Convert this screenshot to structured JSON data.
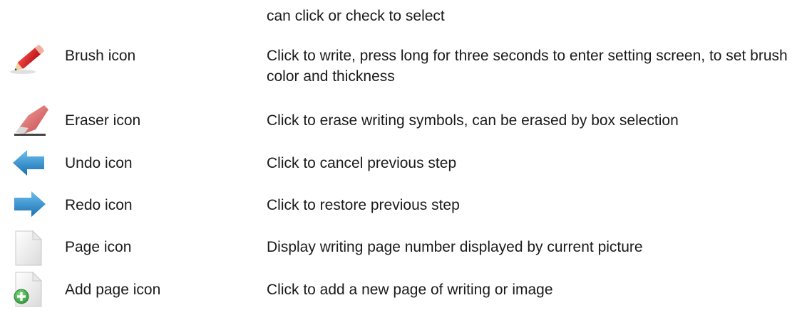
{
  "intro_text": "can click or check to select",
  "rows": [
    {
      "icon": "pencil-icon",
      "label": "Brush icon",
      "description": "Click to write, press long for three seconds to enter setting screen, to set brush color and thickness"
    },
    {
      "icon": "eraser-icon",
      "label": "Eraser icon",
      "description": "Click to erase writing symbols, can be erased by box selection"
    },
    {
      "icon": "undo-arrow-icon",
      "label": "Undo icon",
      "description": "Click to cancel previous step"
    },
    {
      "icon": "redo-arrow-icon",
      "label": "Redo icon",
      "description": "Click to restore previous step"
    },
    {
      "icon": "page-icon",
      "label": "Page icon",
      "description": "Display writing page number displayed by current picture"
    },
    {
      "icon": "add-page-icon",
      "label": "Add page icon",
      "description": "Click to add a new page of writing or image"
    }
  ]
}
